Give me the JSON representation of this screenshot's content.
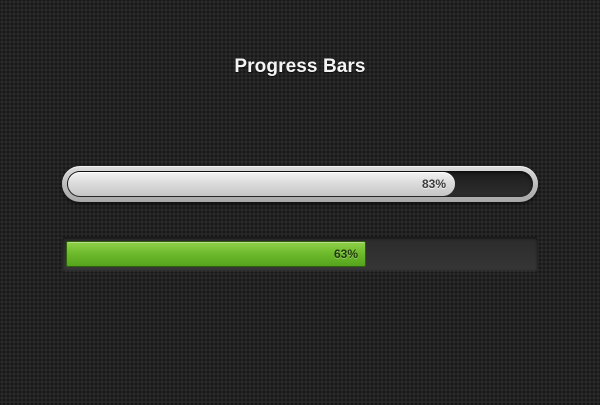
{
  "page": {
    "title": "Progress Bars"
  },
  "progress_bars": [
    {
      "label": "83%",
      "value": 0.83,
      "style": "silver-pill",
      "fill_color": "#d9d9d9",
      "track_color": "#232323"
    },
    {
      "label": "63%",
      "value": 0.63,
      "style": "green-flat",
      "fill_color": "#6cbb2c",
      "track_color": "#2f2f2f"
    }
  ],
  "colors": {
    "background": "#232323",
    "title_text": "#f4f4f4",
    "green_accent": "#6cbb2c"
  }
}
